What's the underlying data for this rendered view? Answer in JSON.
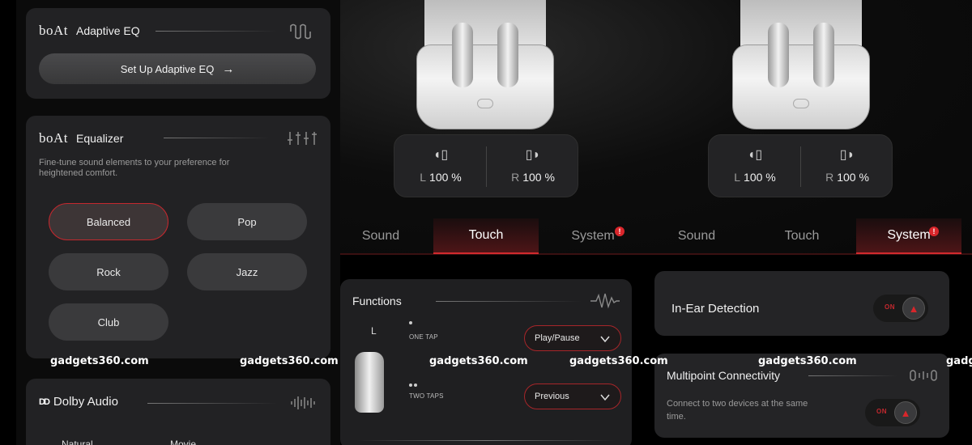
{
  "adaptive_eq": {
    "title": "Adaptive EQ",
    "button": "Set Up Adaptive EQ",
    "arrow": "→"
  },
  "equalizer": {
    "title": "Equalizer",
    "description": "Fine-tune sound elements to your preference for heightened comfort.",
    "presets": [
      "Balanced",
      "Pop",
      "Rock",
      "Jazz",
      "Club"
    ],
    "active": "Balanced"
  },
  "brand": {
    "logo": "boAt"
  },
  "dolby": {
    "logo": "Dolby Audio",
    "mark": "DD",
    "modes_partial": [
      "Natural",
      "Movie"
    ]
  },
  "battery": [
    {
      "left_label": "L",
      "left_value": "100 %",
      "right_label": "R",
      "right_value": "100 %"
    },
    {
      "left_label": "L",
      "left_value": "100 %",
      "right_label": "R",
      "right_value": "100 %"
    }
  ],
  "tabs_1": [
    {
      "label": "Sound"
    },
    {
      "label": "Touch"
    },
    {
      "label": "System"
    }
  ],
  "tabs_2": [
    {
      "label": "Sound"
    },
    {
      "label": "Touch"
    },
    {
      "label": "System"
    }
  ],
  "badge": "!",
  "functions": {
    "title": "Functions",
    "side": "L",
    "one_tap_label": "ONE TAP",
    "one_tap_value": "Play/Pause",
    "two_taps_label": "TWO TAPS",
    "two_taps_value": "Previous"
  },
  "in_ear": {
    "label": "In-Ear Detection",
    "toggle": "ON"
  },
  "multipoint": {
    "label": "Multipoint Connectivity",
    "description": "Connect to two devices at the same time.",
    "toggle": "ON"
  },
  "watermark": [
    "gadgets360.com",
    "gadgets360.com",
    "gadgets360.com",
    "gadgets360.com",
    "gadgets360.com",
    "gadgets360.com",
    "gadg"
  ],
  "colors": {
    "accent": "#c4282e",
    "card": "#222224",
    "background": "#000000"
  },
  "icons": {
    "chevron": "chevron-down-icon",
    "knob": "boat-sail-icon"
  }
}
